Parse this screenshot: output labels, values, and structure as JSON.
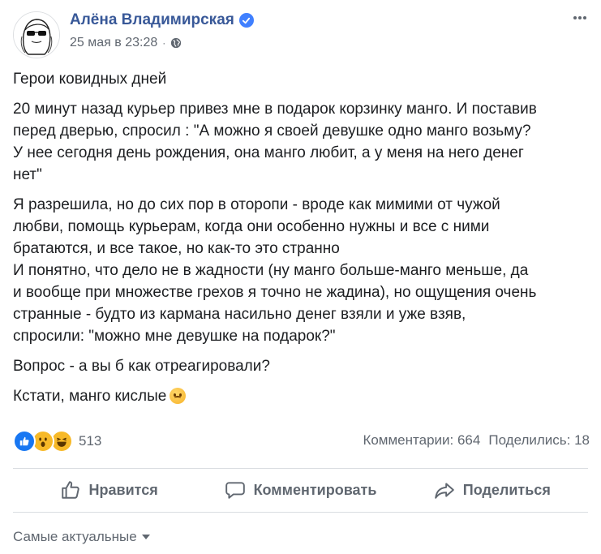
{
  "author": {
    "name": "Алёна Владимирская",
    "verified_icon": "verified-badge-icon",
    "avatar_icon": "avatar-sketch-portrait"
  },
  "post_meta": {
    "date": "25 мая в 23:28",
    "separator": "·",
    "audience_icon": "globe-icon"
  },
  "menu_icon": "more-options-icon",
  "content": {
    "paragraphs": [
      "Герои ковидных дней",
      "20 минут назад курьер привез мне в подарок корзинку манго. И поставив\nперед дверью, спросил : \"А можно я своей девушке одно манго возьму?\nУ нее сегодня день рождения, она манго любит, а у меня на него денег\nнет\"",
      "Я разрешила, но до сих пор в оторопи - вроде как мимими от чужой\nлюбви, помощь курьерам, когда они особенно нужны и все с ними\nбратаются, и все такое, но как-то это странно\nИ понятно, что дело не в жадности (ну манго больше-манго меньше, да\nи вообще при множестве грехов я точно не жадина), но ощущения очень\nстранные - будто из кармана насильно денег взяли и уже взяв,\nспросили: \"можно мне девушке на подарок?\"",
      "Вопрос - а вы б как отреагировали?",
      "Кстати, манго кислые"
    ],
    "trailing_emoji": "sad-face-emoji"
  },
  "reactions": {
    "icons": [
      "like-reaction-icon",
      "wow-reaction-icon",
      "haha-reaction-icon"
    ],
    "count": "513"
  },
  "stats": {
    "comments": "Комментарии: 664",
    "shares": "Поделились: 18"
  },
  "actions": {
    "like_label": "Нравится",
    "comment_label": "Комментировать",
    "share_label": "Поделиться"
  },
  "sort": {
    "label": "Самые актуальные"
  },
  "colors": {
    "author_link": "#385898",
    "muted_text": "#606770",
    "like_blue": "#1877f2",
    "reaction_yellow": "#f7b928",
    "divider": "#dadde1"
  }
}
